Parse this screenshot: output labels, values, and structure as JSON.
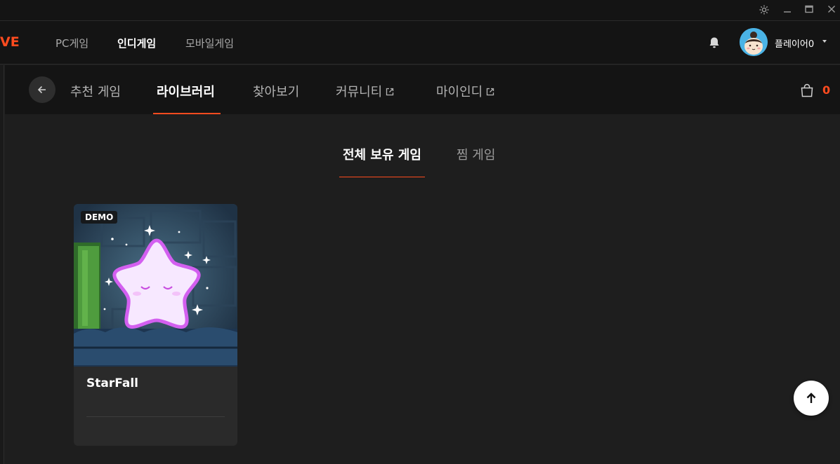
{
  "app": {
    "logo_text": "VE",
    "brand_color": "#ff4b1f"
  },
  "window_controls": [
    "settings-icon",
    "minimize-icon",
    "maximize-icon",
    "close-icon"
  ],
  "top_nav": [
    {
      "label": "PC게임",
      "active": false
    },
    {
      "label": "인디게임",
      "active": true
    },
    {
      "label": "모바일게임",
      "active": false
    }
  ],
  "user": {
    "name": "플레이어0"
  },
  "sub_nav": {
    "tabs": [
      {
        "label": "추천 게임",
        "active": false,
        "external": false
      },
      {
        "label": "라이브러리",
        "active": true,
        "external": false
      },
      {
        "label": "찾아보기",
        "active": false,
        "external": false
      },
      {
        "label": "커뮤니티",
        "active": false,
        "external": true
      },
      {
        "label": "마이인디",
        "active": false,
        "external": true
      }
    ],
    "cart_count": "0"
  },
  "library": {
    "tabs": [
      {
        "label": "전체 보유 게임",
        "active": true
      },
      {
        "label": "찜 게임",
        "active": false
      }
    ],
    "games": [
      {
        "title": "StarFall",
        "badge": "DEMO"
      }
    ]
  }
}
